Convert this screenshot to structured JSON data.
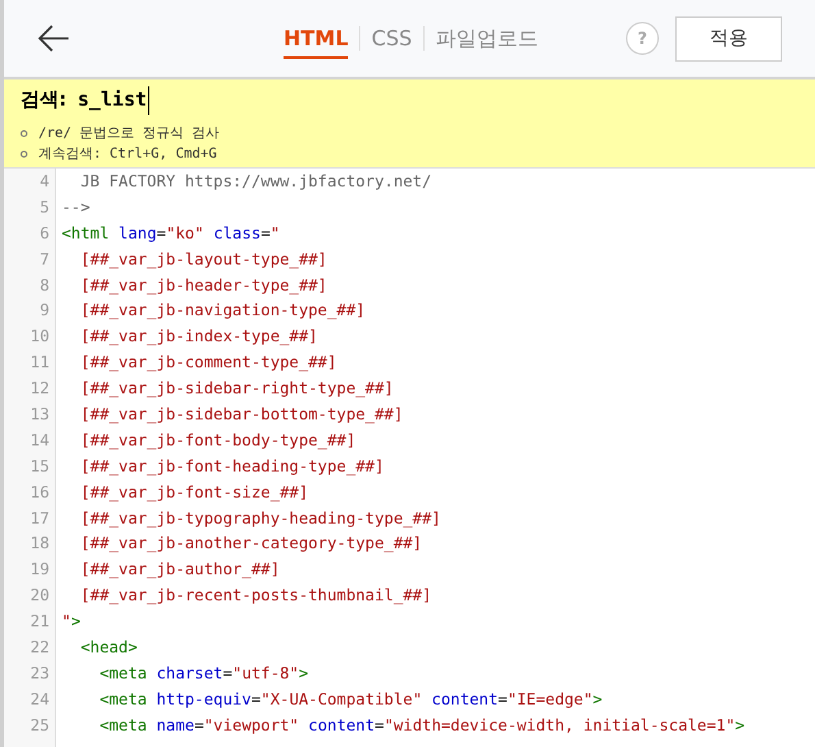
{
  "header": {
    "tabs": [
      {
        "label": "HTML",
        "selected": true
      },
      {
        "label": "CSS",
        "selected": false
      },
      {
        "label": "파일업로드",
        "selected": false
      }
    ],
    "help": "?",
    "apply_button": "적용"
  },
  "search": {
    "label": "검색:",
    "value": "s_list",
    "hints": [
      "/re/ 문법으로 정규식 검사",
      "계속검색: Ctrl+G, Cmd+G"
    ]
  },
  "editor": {
    "lines": [
      {
        "number": "4",
        "tokens": [
          {
            "kind": "comment",
            "text": "  JB FACTORY https://www.jbfactory.net/"
          }
        ]
      },
      {
        "number": "5",
        "tokens": [
          {
            "kind": "comment",
            "text": "-->"
          }
        ]
      },
      {
        "number": "6",
        "tokens": [
          {
            "kind": "tag",
            "text": "<html"
          },
          {
            "kind": "attr",
            "text": " lang"
          },
          {
            "kind": "plain",
            "text": "="
          },
          {
            "kind": "string",
            "text": "\"ko\""
          },
          {
            "kind": "attr",
            "text": " class"
          },
          {
            "kind": "plain",
            "text": "="
          },
          {
            "kind": "string",
            "text": "\""
          }
        ]
      },
      {
        "number": "7",
        "tokens": [
          {
            "kind": "string",
            "text": "  [##_var_jb-layout-type_##]"
          }
        ]
      },
      {
        "number": "8",
        "tokens": [
          {
            "kind": "string",
            "text": "  [##_var_jb-header-type_##]"
          }
        ]
      },
      {
        "number": "9",
        "tokens": [
          {
            "kind": "string",
            "text": "  [##_var_jb-navigation-type_##]"
          }
        ]
      },
      {
        "number": "10",
        "tokens": [
          {
            "kind": "string",
            "text": "  [##_var_jb-index-type_##]"
          }
        ]
      },
      {
        "number": "11",
        "tokens": [
          {
            "kind": "string",
            "text": "  [##_var_jb-comment-type_##]"
          }
        ]
      },
      {
        "number": "12",
        "tokens": [
          {
            "kind": "string",
            "text": "  [##_var_jb-sidebar-right-type_##]"
          }
        ]
      },
      {
        "number": "13",
        "tokens": [
          {
            "kind": "string",
            "text": "  [##_var_jb-sidebar-bottom-type_##]"
          }
        ]
      },
      {
        "number": "14",
        "tokens": [
          {
            "kind": "string",
            "text": "  [##_var_jb-font-body-type_##]"
          }
        ]
      },
      {
        "number": "15",
        "tokens": [
          {
            "kind": "string",
            "text": "  [##_var_jb-font-heading-type_##]"
          }
        ]
      },
      {
        "number": "16",
        "tokens": [
          {
            "kind": "string",
            "text": "  [##_var_jb-font-size_##]"
          }
        ]
      },
      {
        "number": "17",
        "tokens": [
          {
            "kind": "string",
            "text": "  [##_var_jb-typography-heading-type_##]"
          }
        ]
      },
      {
        "number": "18",
        "tokens": [
          {
            "kind": "string",
            "text": "  [##_var_jb-another-category-type_##]"
          }
        ]
      },
      {
        "number": "19",
        "tokens": [
          {
            "kind": "string",
            "text": "  [##_var_jb-author_##]"
          }
        ]
      },
      {
        "number": "20",
        "tokens": [
          {
            "kind": "string",
            "text": "  [##_var_jb-recent-posts-thumbnail_##]"
          }
        ]
      },
      {
        "number": "21",
        "tokens": [
          {
            "kind": "string",
            "text": "\""
          },
          {
            "kind": "tag",
            "text": ">"
          }
        ]
      },
      {
        "number": "22",
        "tokens": [
          {
            "kind": "tag",
            "text": "  <head>"
          }
        ]
      },
      {
        "number": "23",
        "tokens": [
          {
            "kind": "tag",
            "text": "    <meta"
          },
          {
            "kind": "attr",
            "text": " charset"
          },
          {
            "kind": "plain",
            "text": "="
          },
          {
            "kind": "string",
            "text": "\"utf-8\""
          },
          {
            "kind": "tag",
            "text": ">"
          }
        ]
      },
      {
        "number": "24",
        "tokens": [
          {
            "kind": "tag",
            "text": "    <meta"
          },
          {
            "kind": "attr",
            "text": " http-equiv"
          },
          {
            "kind": "plain",
            "text": "="
          },
          {
            "kind": "string",
            "text": "\"X-UA-Compatible\""
          },
          {
            "kind": "attr",
            "text": " content"
          },
          {
            "kind": "plain",
            "text": "="
          },
          {
            "kind": "string",
            "text": "\"IE=edge\""
          },
          {
            "kind": "tag",
            "text": ">"
          }
        ]
      },
      {
        "number": "25",
        "tokens": [
          {
            "kind": "tag",
            "text": "    <meta"
          },
          {
            "kind": "attr",
            "text": " name"
          },
          {
            "kind": "plain",
            "text": "="
          },
          {
            "kind": "string",
            "text": "\"viewport\""
          },
          {
            "kind": "attr",
            "text": " content"
          },
          {
            "kind": "plain",
            "text": "="
          },
          {
            "kind": "string",
            "text": "\"width=device-width, initial-scale=1\""
          },
          {
            "kind": "tag",
            "text": ">"
          }
        ]
      }
    ]
  }
}
